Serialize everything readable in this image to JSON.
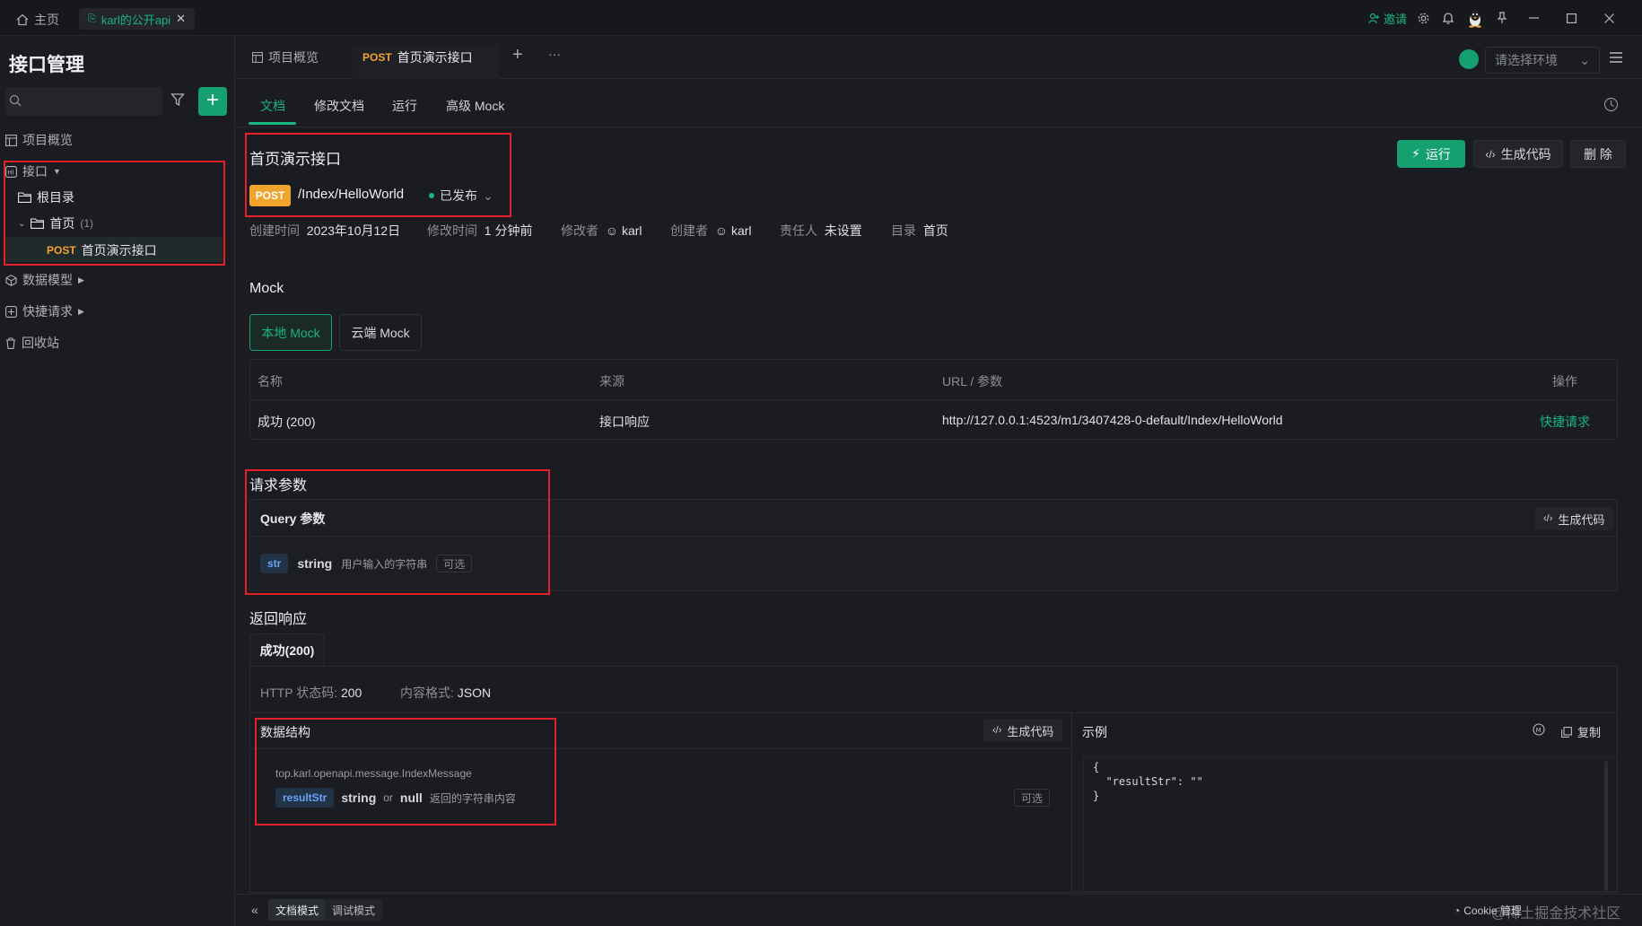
{
  "titlebar": {
    "home_label": "主页",
    "project_tab": "karl的公开api",
    "invite_label": "邀请"
  },
  "sidebar": {
    "title": "接口管理",
    "search_placeholder": "",
    "items": [
      {
        "label": "项目概览",
        "icon": "layout-icon"
      },
      {
        "label": "接口",
        "icon": "api-icon"
      },
      {
        "label": "数据模型",
        "icon": "cube-icon"
      },
      {
        "label": "快捷请求",
        "icon": "quick-request-icon"
      },
      {
        "label": "回收站",
        "icon": "trash-icon"
      }
    ],
    "tree": {
      "root_label": "根目录",
      "folder_label": "首页",
      "folder_count": "(1)",
      "endpoint_method": "POST",
      "endpoint_name": "首页演示接口"
    }
  },
  "tabs": {
    "overview_label": "项目概览",
    "active_method": "POST",
    "active_label": "首页演示接口",
    "add_label": "+",
    "more_label": "···",
    "env_placeholder": "请选择环境"
  },
  "subtabs": [
    "文档",
    "修改文档",
    "运行",
    "高级 Mock"
  ],
  "header": {
    "title": "首页演示接口",
    "method": "POST",
    "path": "/Index/HelloWorld",
    "status": "已发布",
    "run_label": "运行",
    "gen_code_label": "生成代码",
    "delete_label": "删 除"
  },
  "meta": {
    "created_label": "创建时间",
    "created_value": "2023年10月12日",
    "modified_label": "修改时间",
    "modified_value": "1 分钟前",
    "modifier_label": "修改者",
    "modifier_value": "karl",
    "creator_label": "创建者",
    "creator_value": "karl",
    "owner_label": "责任人",
    "owner_value": "未设置",
    "dir_label": "目录",
    "dir_value": "首页"
  },
  "mock": {
    "heading": "Mock",
    "local_label": "本地 Mock",
    "cloud_label": "云端 Mock",
    "columns": [
      "名称",
      "来源",
      "URL / 参数",
      "操作"
    ],
    "row": {
      "name": "成功 (200)",
      "source": "接口响应",
      "url": "http://127.0.0.1:4523/m1/3407428-0-default/Index/HelloWorld",
      "action": "快捷请求"
    }
  },
  "request": {
    "heading": "请求参数",
    "query_label": "Query 参数",
    "gen_code_label": "生成代码",
    "param": {
      "name": "str",
      "type": "string",
      "desc": "用户输入的字符串",
      "optional": "可选"
    }
  },
  "response": {
    "heading": "返回响应",
    "tab_label": "成功(200)",
    "status_label": "HTTP 状态码:",
    "status_value": "200",
    "format_label": "内容格式:",
    "format_value": "JSON",
    "schema_label": "数据结构",
    "schema_gen_code": "生成代码",
    "schema_class": "top.karl.openapi.message.IndexMessage",
    "field": {
      "name": "resultStr",
      "type": "string",
      "or": "or",
      "null": "null",
      "desc": "返回的字符串内容",
      "optional": "可选"
    },
    "example_label": "示例",
    "copy_label": "复制",
    "example_lines": [
      "{",
      "  \"resultStr\": \"\"",
      "}"
    ]
  },
  "bottom": {
    "doc_mode": "文档模式",
    "debug_mode": "调试模式",
    "cookie_label": "Cookie 管理",
    "watermark": "@稀土掘金技术社区"
  },
  "colors": {
    "accent": "#18b57f",
    "post": "#f0a42c",
    "highlight": "#e5202a"
  }
}
